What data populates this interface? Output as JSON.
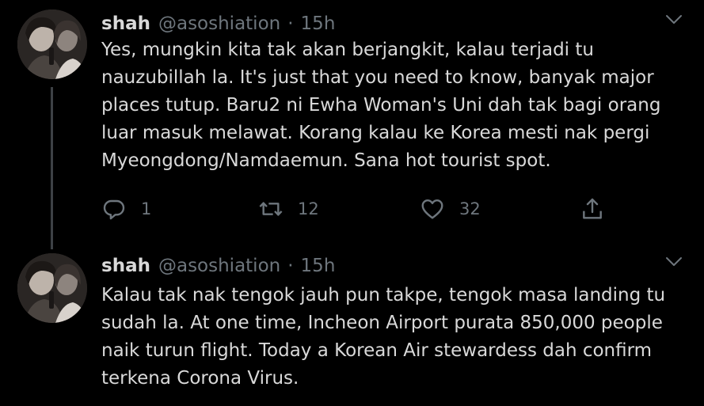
{
  "colors": {
    "background": "#000000",
    "text": "#d9d9d9",
    "secondary": "#6e767d",
    "thread_line": "#3d4145"
  },
  "tweets": [
    {
      "name": "shah",
      "handle": "@asoshiation",
      "separator": "·",
      "time": "15h",
      "text": "Yes, mungkin kita tak akan berjangkit, kalau terjadi tu\nnauzubillah la. It's just that you need to know, banyak major\nplaces tutup. Baru2 ni Ewha Woman's Uni dah tak bagi orang\nluar masuk melawat. Korang kalau ke Korea mesti nak pergi\nMyeongdong/Namdaemun. Sana hot tourist spot.",
      "reply_count": "1",
      "retweet_count": "12",
      "like_count": "32",
      "icons": [
        "reply-icon",
        "retweet-icon",
        "like-icon",
        "share-icon",
        "chevron-down-icon"
      ]
    },
    {
      "name": "shah",
      "handle": "@asoshiation",
      "separator": "·",
      "time": "15h",
      "text": "Kalau tak nak tengok jauh pun takpe, tengok masa landing tu\nsudah la. At one time, Incheon Airport purata 850,000 people\nnaik turun flight. Today a Korean Air stewardess dah confirm\nterkena Corona Virus.",
      "icons": [
        "chevron-down-icon"
      ]
    }
  ]
}
